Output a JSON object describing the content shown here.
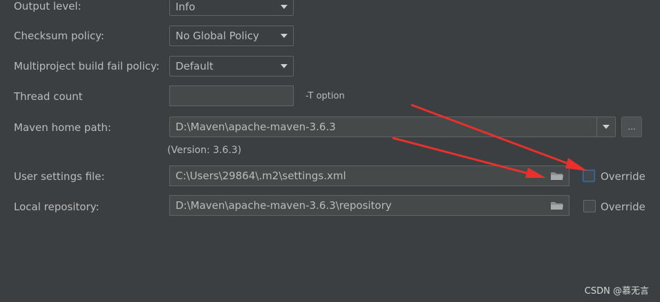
{
  "output_level": {
    "label": "Output level:",
    "value": "Info"
  },
  "checksum_policy": {
    "label": "Checksum policy:",
    "value": "No Global Policy"
  },
  "multiproject": {
    "label": "Multiproject build fail policy:",
    "value": "Default"
  },
  "thread_count": {
    "label": "Thread count",
    "value": "",
    "hint": "-T option"
  },
  "maven_home": {
    "label": "Maven home path:",
    "value": "D:\\Maven\\apache-maven-3.6.3",
    "version": "(Version: 3.6.3)",
    "browse_label": "..."
  },
  "user_settings": {
    "label": "User settings file:",
    "value": "C:\\Users\\29864\\.m2\\settings.xml",
    "override_label": "Override",
    "override_checked": false
  },
  "local_repo": {
    "label": "Local repository:",
    "value": "D:\\Maven\\apache-maven-3.6.3\\repository",
    "override_label": "Override",
    "override_checked": false
  },
  "watermark": "CSDN @慕无言",
  "colors": {
    "background": "#3c3f41",
    "text": "#bbbbbb",
    "arrow_annotation": "#e8302c",
    "focus": "#3d6185"
  }
}
